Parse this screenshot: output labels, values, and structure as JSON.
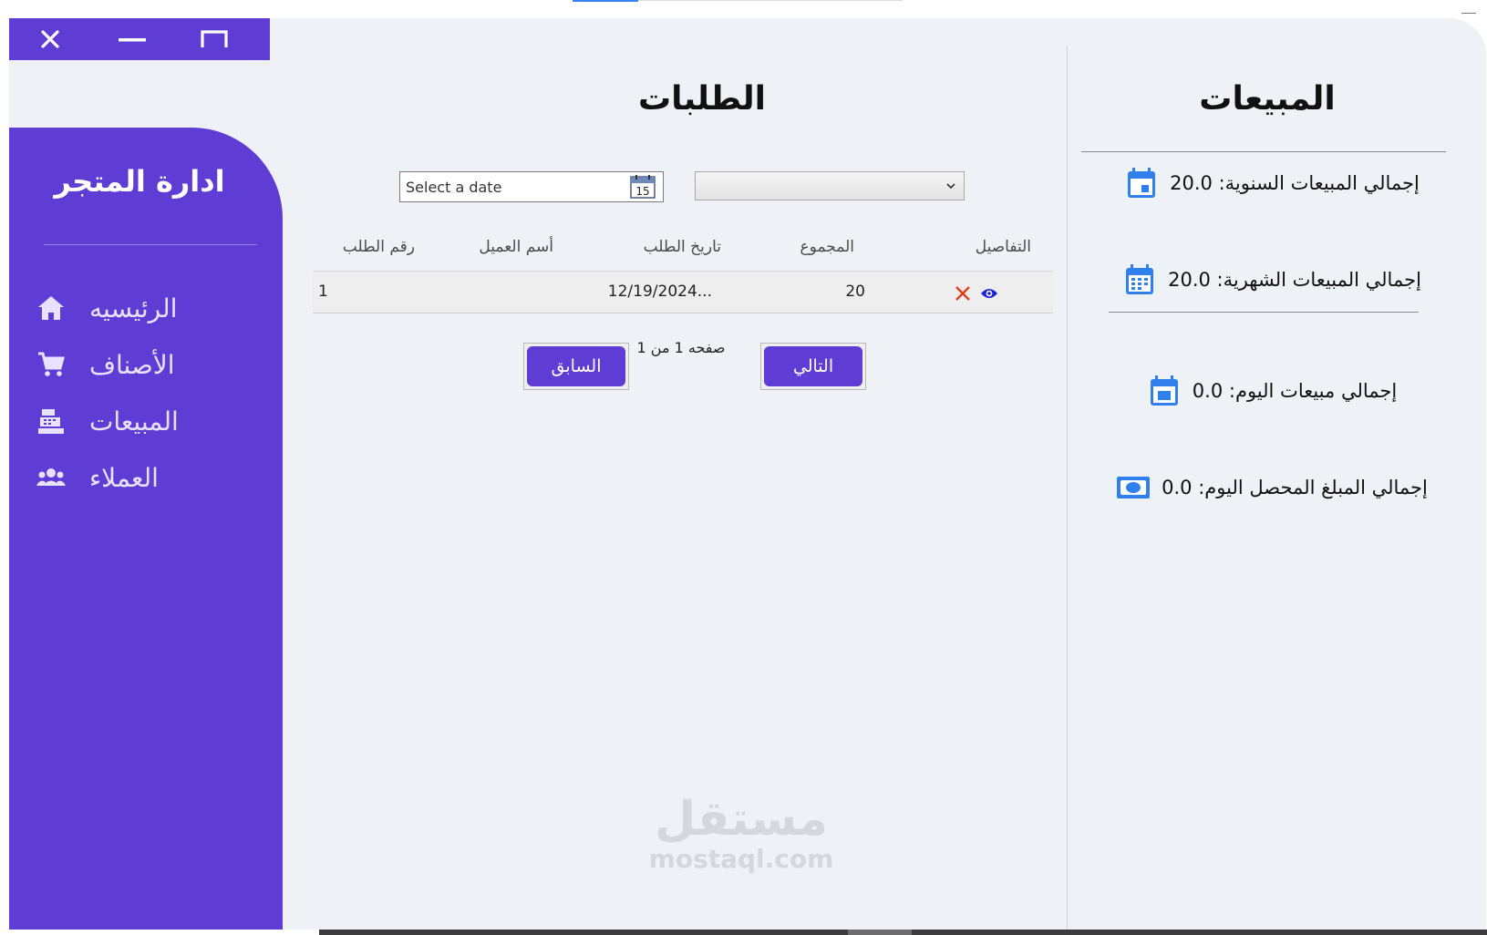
{
  "window_controls": {
    "close_icon": "close-icon",
    "minimize_icon": "minimize-icon",
    "maximize_icon": "maximize-icon"
  },
  "sidebar": {
    "title": "ادارة المتجر",
    "items": [
      {
        "label": "الرئيسيه",
        "icon": "home-icon"
      },
      {
        "label": "الأصناف",
        "icon": "cart-icon"
      },
      {
        "label": "المبيعات",
        "icon": "cash-register-icon"
      },
      {
        "label": "العملاء",
        "icon": "people-icon"
      }
    ]
  },
  "orders": {
    "title": "الطلبات",
    "date_placeholder": "Select a date",
    "calendar_day": "15",
    "dropdown_value": "",
    "columns": [
      "التفاصيل",
      "المجموع",
      "تاريخ الطلب",
      "أسم العميل",
      "رقم الطلب"
    ],
    "rows": [
      {
        "total": "20",
        "date": "12/19/2024...",
        "customer": "",
        "order_no": "1"
      }
    ],
    "pagination": {
      "next_label": "التالي",
      "prev_label": "السابق",
      "page_info": "صفحه 1 من 1"
    }
  },
  "sales": {
    "title": "المبيعات",
    "yearly": "إجمالي المبيعات السنوية: 20.0",
    "monthly": "إجمالي المبيعات الشهرية: 20.0",
    "daily": "إجمالي مبيعات اليوم: 0.0",
    "collected": "إجمالي المبلغ المحصل اليوم: 0.0"
  },
  "watermark": {
    "arabic": "مستقل",
    "latin": "mostaql.com"
  },
  "colors": {
    "primary": "#5f3dd4",
    "background": "#eef1f6",
    "icon_blue": "#2f80ed",
    "delete_red": "#e0401a",
    "view_blue": "#1a22d6"
  }
}
